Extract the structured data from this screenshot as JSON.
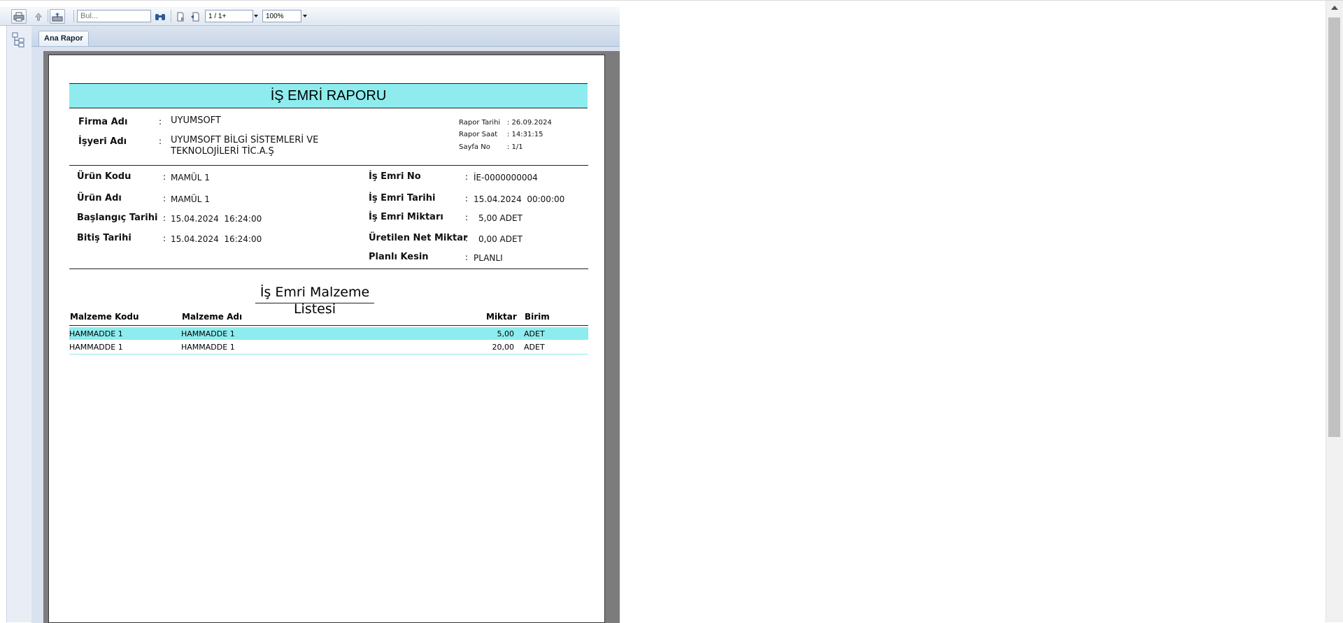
{
  "toolbar": {
    "find_placeholder": "Bul...",
    "page_indicator": "1 / 1+",
    "zoom": "100%",
    "icons": [
      "printer-icon",
      "upload-icon",
      "export-icon",
      "binoculars-icon",
      "page-icon",
      "back-page-icon"
    ]
  },
  "tabs": [
    {
      "label": "Ana Rapor"
    }
  ],
  "report": {
    "title": "İŞ EMRİ RAPORU",
    "header": {
      "firma_label": "Firma Adı",
      "firma_value": "UYUMSOFT",
      "isyeri_label": "İşyeri Adı",
      "isyeri_value_line1": "UYUMSOFT BİLGİ SİSTEMLERİ VE",
      "isyeri_value_line2": "TEKNOLOJİLERİ TİC.A.Ş",
      "rapor_tarihi_label": "Rapor Tarihi",
      "rapor_tarihi_value": ": 26.09.2024",
      "rapor_saat_label": "Rapor Saat",
      "rapor_saat_value": ": 14:31:15",
      "sayfa_label": "Sayfa No",
      "sayfa_value": ": 1/1"
    },
    "details": {
      "urun_kodu_label": "Ürün Kodu",
      "urun_kodu_value": "MAMÜL 1",
      "urun_adi_label": "Ürün Adı",
      "urun_adi_value": "MAMÜL 1",
      "baslangic_label": "Başlangıç Tarihi",
      "baslangic_value": "15.04.2024  16:24:00",
      "bitis_label": "Bitiş Tarihi",
      "bitis_value": "15.04.2024  16:24:00",
      "is_emri_no_label": "İş Emri No",
      "is_emri_no_value": "İE-0000000004",
      "is_emri_tarihi_label": "İş Emri Tarihi",
      "is_emri_tarihi_value": "15.04.2024  00:00:00",
      "is_emri_miktari_label": "İş Emri Miktarı",
      "is_emri_miktari_value": "5,00 ADET",
      "uretilen_label": "Üretilen Net Miktar",
      "uretilen_value": "0,00 ADET",
      "planli_label": "Planlı Kesin",
      "planli_value": "PLANLI"
    },
    "list_title": "İş Emri Malzeme Listesi",
    "columns": {
      "kod": "Malzeme Kodu",
      "ad": "Malzeme Adı",
      "miktar": "Miktar",
      "birim": "Birim"
    },
    "rows": [
      {
        "kod": "HAMMADDE 1",
        "ad": "HAMMADDE 1",
        "miktar": "5,00",
        "birim": "ADET"
      },
      {
        "kod": "HAMMADDE 1",
        "ad": "HAMMADDE 1",
        "miktar": "20,00",
        "birim": "ADET"
      }
    ]
  },
  "colors": {
    "accent": "#8eecee",
    "frame": "#d9e2ee"
  }
}
